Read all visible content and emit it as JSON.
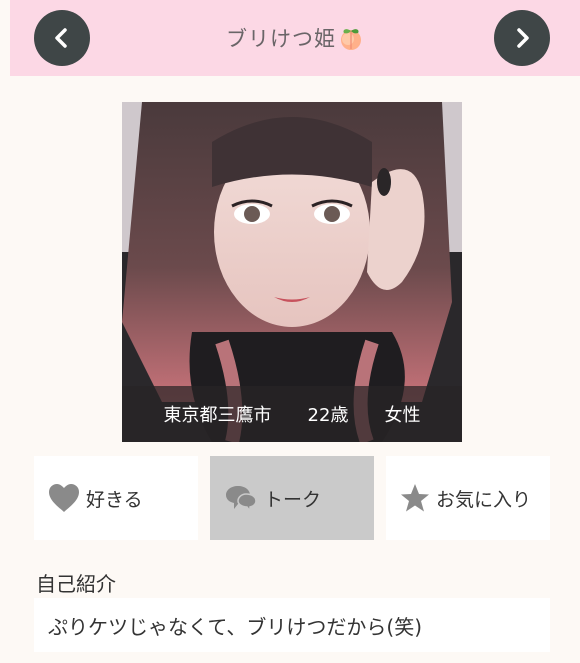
{
  "header": {
    "title": "ブリけつ姫",
    "title_emoji": "peach-icon",
    "background_color": "#fcd8e5",
    "prev_icon": "chevron-left-icon",
    "next_icon": "chevron-right-icon"
  },
  "profile": {
    "location": "東京都三鷹市",
    "age": "22歳",
    "gender": "女性"
  },
  "actions": {
    "like_label": "好きる",
    "talk_label": "トーク",
    "favorite_label": "お気に入り",
    "like_icon": "heart-icon",
    "talk_icon": "chat-bubbles-icon",
    "favorite_icon": "star-icon"
  },
  "intro": {
    "heading": "自己紹介",
    "text": "ぷりケツじゃなくて、ブリけつだから(笑)"
  }
}
